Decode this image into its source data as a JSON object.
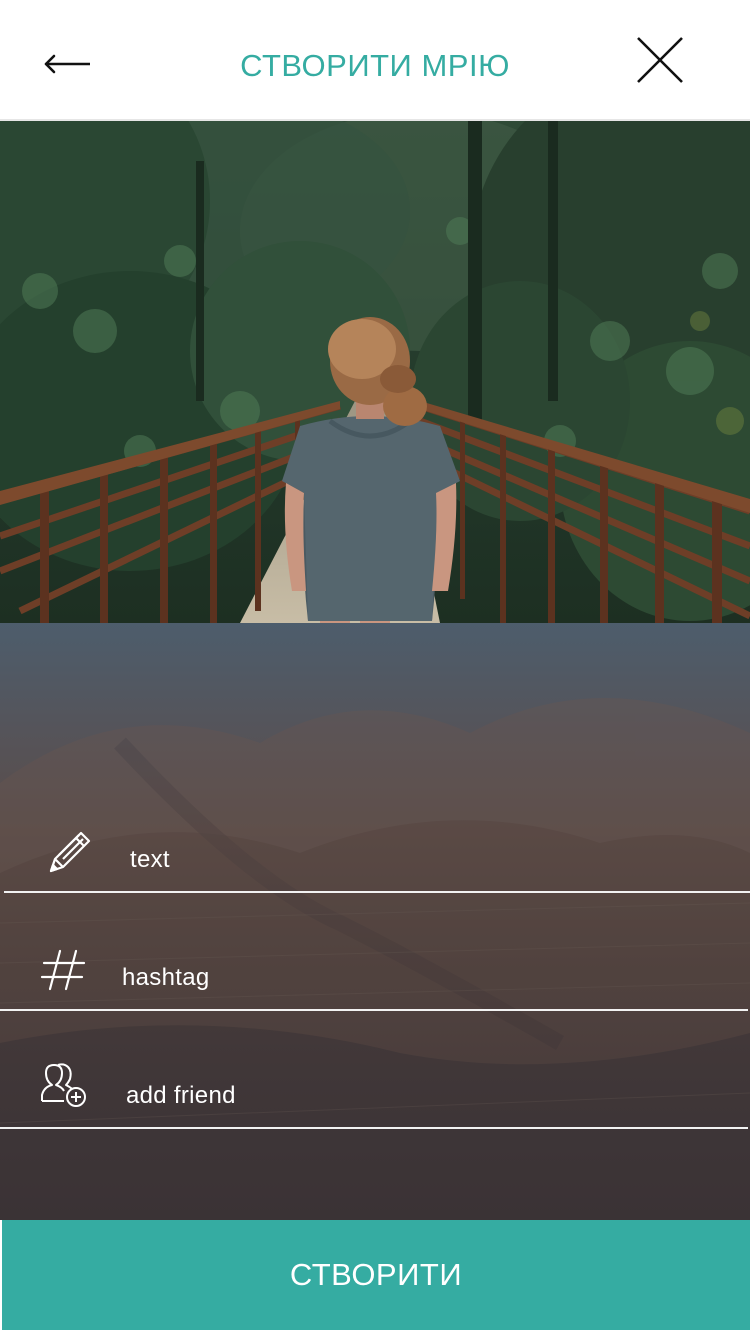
{
  "header": {
    "title": "СТВОРИТИ МРІЮ",
    "back_icon": "arrow-left-icon",
    "close_icon": "close-icon",
    "accent_color": "#35aca2"
  },
  "hero": {
    "image_description_icon": "photo"
  },
  "form": {
    "fields": [
      {
        "icon": "pencil-icon",
        "placeholder": "text"
      },
      {
        "icon": "hashtag-icon",
        "placeholder": "hashtag"
      },
      {
        "icon": "add-friend-icon",
        "placeholder": "add friend"
      }
    ]
  },
  "submit": {
    "label": "СТВОРИТИ",
    "color": "#35aca2"
  }
}
